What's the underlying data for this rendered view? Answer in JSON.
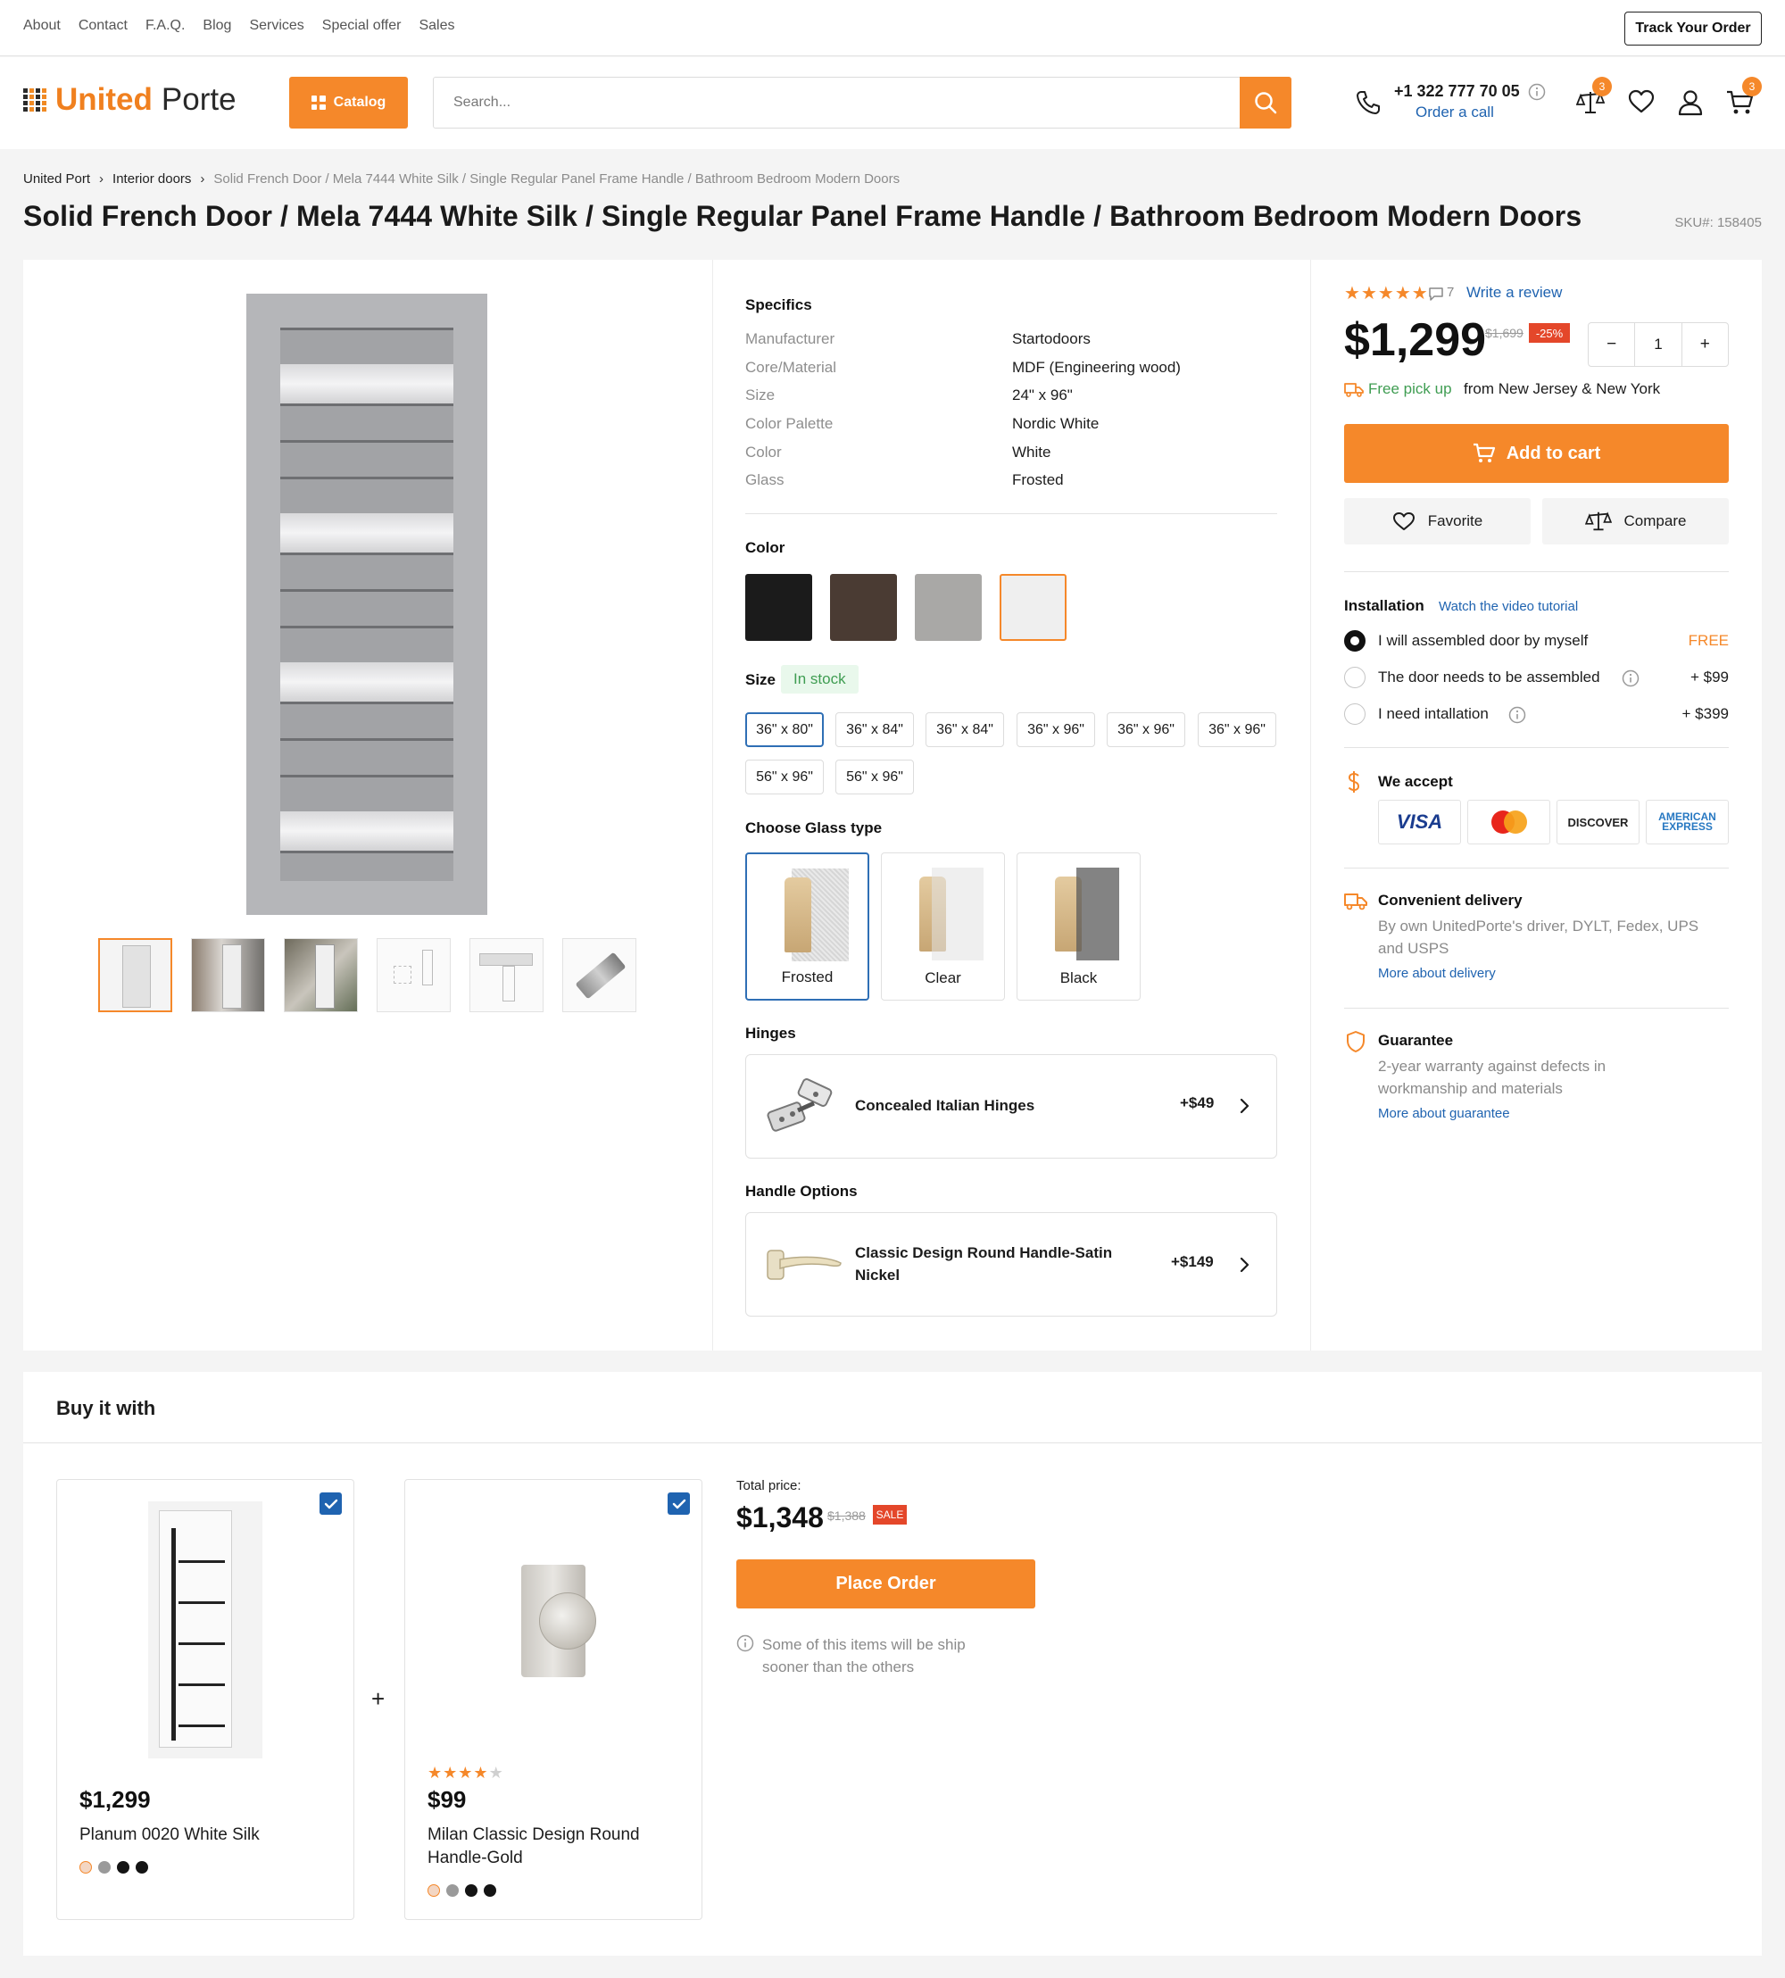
{
  "topnav": [
    "About",
    "Contact",
    "F.A.Q.",
    "Blog",
    "Services",
    "Special offer",
    "Sales"
  ],
  "track_order": "Track Your Order",
  "brand": {
    "part1": "United",
    "part2": "Porte"
  },
  "catalog_label": "Catalog",
  "search": {
    "placeholder": "Search..."
  },
  "contact": {
    "phone": "+1 322 777 70 05",
    "call_label": "Order a call"
  },
  "header_badges": {
    "compare": "3",
    "cart": "3"
  },
  "breadcrumb": {
    "items": [
      "United Port",
      "Interior doors"
    ],
    "current": "Solid French Door / Mela 7444 White Silk / Single Regular Panel Frame Handle / Bathroom Bedroom Modern Doors"
  },
  "title": "Solid French Door / Mela 7444 White Silk / Single Regular Panel Frame Handle / Bathroom Bedroom Modern Doors",
  "sku": "SKU#: 158405",
  "specifics": {
    "heading": "Specifics",
    "rows": [
      {
        "key": "Manufacturer",
        "value": "Startodoors"
      },
      {
        "key": "Core/Material",
        "value": "MDF (Engineering wood)"
      },
      {
        "key": "Size",
        "value": "24\" x 96\""
      },
      {
        "key": "Color Palette",
        "value": "Nordic White"
      },
      {
        "key": "Color",
        "value": "White"
      },
      {
        "key": "Glass",
        "value": "Frosted"
      }
    ]
  },
  "color": {
    "heading": "Color",
    "swatches": [
      "#1b1b1b",
      "#4a3b33",
      "#a9a8a6",
      "#efefef"
    ],
    "selected_index": 3
  },
  "size": {
    "heading": "Size",
    "stock": "In stock",
    "options": [
      "36\" x 80\"",
      "36\" x 84\"",
      "36\" x 84\"",
      "36\" x 96\"",
      "36\" x 96\"",
      "36\" x 96\"",
      "56\" x 96\"",
      "56\" x 96\""
    ],
    "selected_index": 0
  },
  "glass": {
    "heading": "Choose Glass type",
    "options": [
      "Frosted",
      "Clear",
      "Black"
    ],
    "selected_index": 0
  },
  "hinges": {
    "heading": "Hinges",
    "name": "Concealed Italian Hinges",
    "price": "+$49"
  },
  "handle": {
    "heading": "Handle Options",
    "name_line1": "Classic Design Round Handle-Satin",
    "name_line2": "Nickel",
    "price": "+$149"
  },
  "rating": {
    "stars": 5,
    "reviews": "7",
    "write_review": "Write a review"
  },
  "price": {
    "current": "$1,299",
    "old": "$1,699",
    "discount": "-25%"
  },
  "quantity": "1",
  "pickup": {
    "label": "Free pick up",
    "location": "from New Jersey & New York"
  },
  "add_to_cart": "Add to cart",
  "favorite": "Favorite",
  "compare": "Compare",
  "installation": {
    "heading": "Installation",
    "tutorial": "Watch the video tutorial",
    "options": [
      {
        "label": "I will assembled door by myself",
        "price": "FREE"
      },
      {
        "label": "The door needs to be assembled",
        "price": "+ $99"
      },
      {
        "label": "I need intallation",
        "price": "+ $399"
      }
    ],
    "selected_index": 0
  },
  "we_accept": {
    "heading": "We accept",
    "cards": [
      "VISA",
      "Mastercard",
      "DISCOVER",
      "AMERICAN EXPRESS"
    ]
  },
  "delivery": {
    "heading": "Convenient delivery",
    "text": "By own UnitedPorte's driver, DYLT, Fedex, UPS and USPS",
    "link": "More about delivery"
  },
  "guarantee": {
    "heading": "Guarantee",
    "text": "2-year warranty against defects in workmanship and materials",
    "link": "More about guarantee"
  },
  "buy_with": {
    "heading": "Buy it with",
    "products": [
      {
        "price": "$1,299",
        "name": "Planum 0020 White Silk",
        "colors": [
          "#f3d6c3",
          "#9a9a9a",
          "#141414",
          "#141414"
        ]
      },
      {
        "price": "$99",
        "name": "Milan Classic Design Round Handle-Gold",
        "stars": 4,
        "colors": [
          "#f3d6c3",
          "#9a9a9a",
          "#141414",
          "#141414"
        ]
      }
    ],
    "total_label": "Total price:",
    "total": "$1,348",
    "total_old": "$1,388",
    "sale": "SALE",
    "place_order": "Place Order",
    "note_line1": "Some of this items will be ship",
    "note_line2": "sooner than the others"
  },
  "colors": {
    "accent": "#f5882a",
    "link": "#1f63b0",
    "sale": "#e4472a"
  }
}
